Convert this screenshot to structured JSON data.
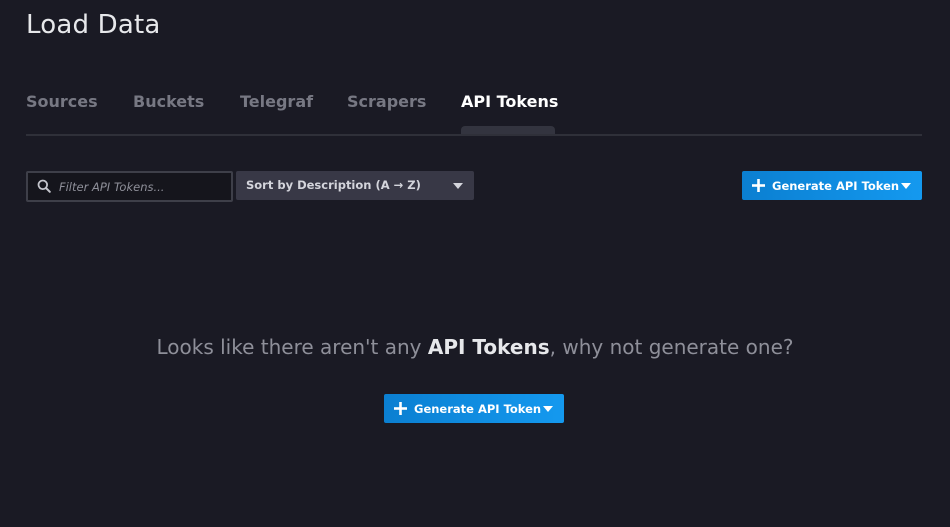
{
  "page": {
    "title": "Load Data"
  },
  "tabs": [
    {
      "label": "Sources",
      "active": false
    },
    {
      "label": "Buckets",
      "active": false
    },
    {
      "label": "Telegraf",
      "active": false
    },
    {
      "label": "Scrapers",
      "active": false
    },
    {
      "label": "API Tokens",
      "active": true
    }
  ],
  "toolbar": {
    "filter_placeholder": "Filter API Tokens...",
    "filter_value": "",
    "sort_label": "Sort by Description (A → Z)",
    "generate_label": "Generate API Token"
  },
  "empty_state": {
    "text_before": "Looks like there aren't any ",
    "highlight": "API Tokens",
    "text_after": ", why not generate one?",
    "generate_label": "Generate API Token"
  },
  "icons": {
    "search": "search-icon",
    "plus": "plus-icon",
    "caret": "caret-down-icon"
  },
  "colors": {
    "background": "#1a1a24",
    "primary_button": "#0a8ee8",
    "active_tab": "#ffffff",
    "inactive_tab": "#777883"
  }
}
